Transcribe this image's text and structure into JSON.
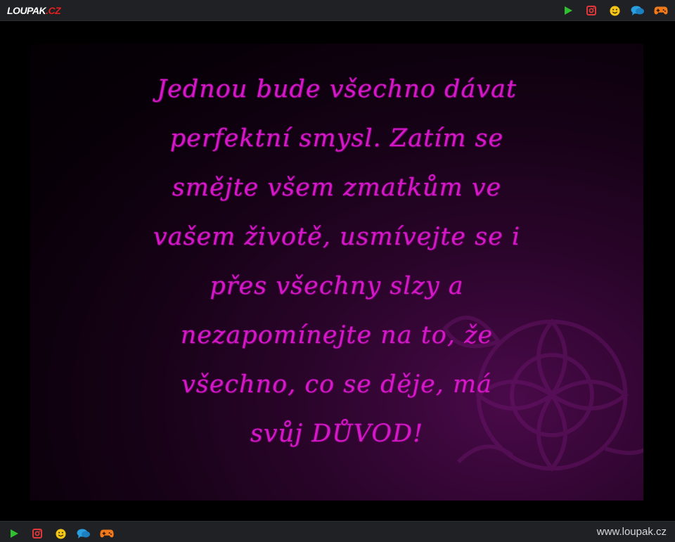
{
  "header": {
    "logo_main": "LOUPAK",
    "logo_suffix": ".CZ",
    "icons": [
      "play-icon",
      "instagram-icon",
      "smiley-icon",
      "chat-icon",
      "gamepad-icon"
    ]
  },
  "content": {
    "lines": [
      "Jednou bude všechno dávat",
      "perfektní smysl. Zatím se",
      "smějte všem zmatkům ve",
      "vašem životě, usmívejte se i",
      "přes všechny slzy a",
      "nezapomínejte na to, že",
      "všechno, co se děje, má",
      "svůj DŮVOD!"
    ]
  },
  "footer": {
    "site_url": "www.loupak.cz",
    "icons": [
      "play-icon",
      "instagram-icon",
      "smiley-icon",
      "chat-icon",
      "gamepad-icon"
    ]
  },
  "colors": {
    "bar_bg": "#1f2124",
    "quote_text": "#d418c8",
    "play": "#2fbf2f",
    "instagram": "#e0383a",
    "smiley": "#f5c518",
    "chat": "#2a9fe0",
    "gamepad": "#f07a1a"
  }
}
